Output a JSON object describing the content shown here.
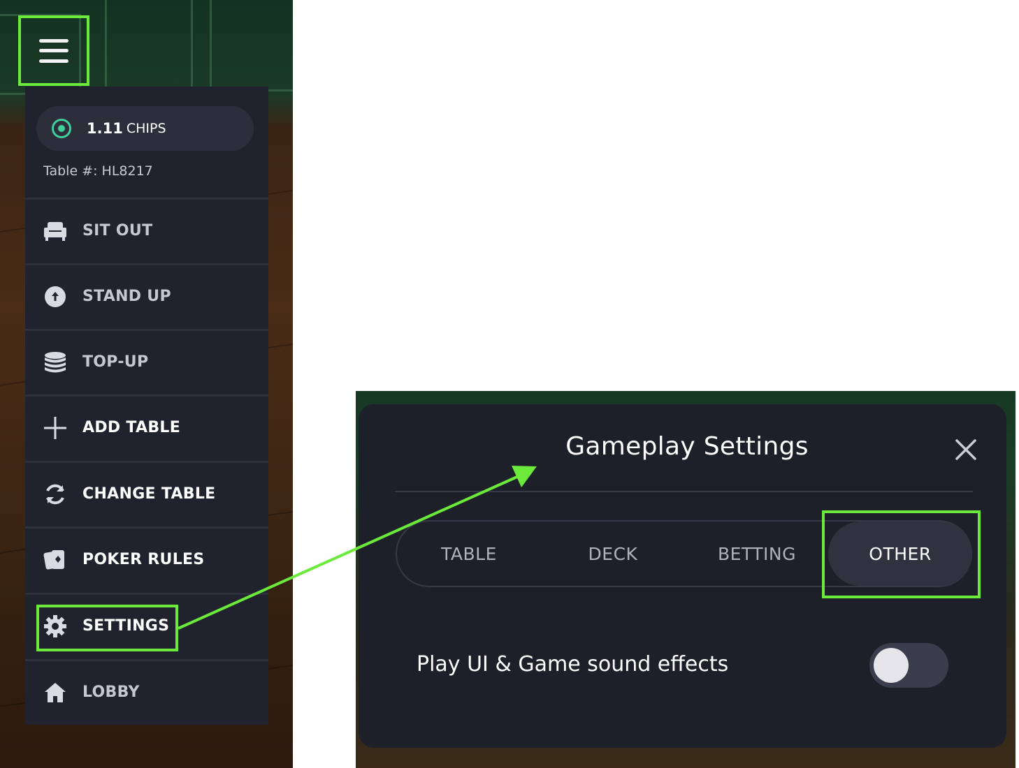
{
  "menu": {
    "chips_amount": "1.11",
    "chips_unit": "CHIPS",
    "table_number": "Table #:  HL8217",
    "items": [
      {
        "label": "SIT OUT",
        "icon": "armchair-icon"
      },
      {
        "label": "STAND UP",
        "icon": "arrow-up-circle-icon"
      },
      {
        "label": "TOP-UP",
        "icon": "coin-stack-icon"
      },
      {
        "label": "ADD TABLE",
        "icon": "plus-icon"
      },
      {
        "label": "CHANGE TABLE",
        "icon": "refresh-icon"
      },
      {
        "label": "POKER RULES",
        "icon": "cards-icon"
      },
      {
        "label": "SETTINGS",
        "icon": "gear-icon"
      },
      {
        "label": "LOBBY",
        "icon": "home-icon"
      }
    ]
  },
  "modal": {
    "title": "Gameplay Settings",
    "tabs": [
      "TABLE",
      "DECK",
      "BETTING",
      "OTHER"
    ],
    "active_tab": "OTHER",
    "sound_label": "Play UI & Game sound effects",
    "sound_enabled": false
  },
  "colors": {
    "highlight": "#6bea3c",
    "menu_bg": "#20222d",
    "modal_bg": "#1e2029",
    "chip_accent": "#3fcf9a"
  }
}
